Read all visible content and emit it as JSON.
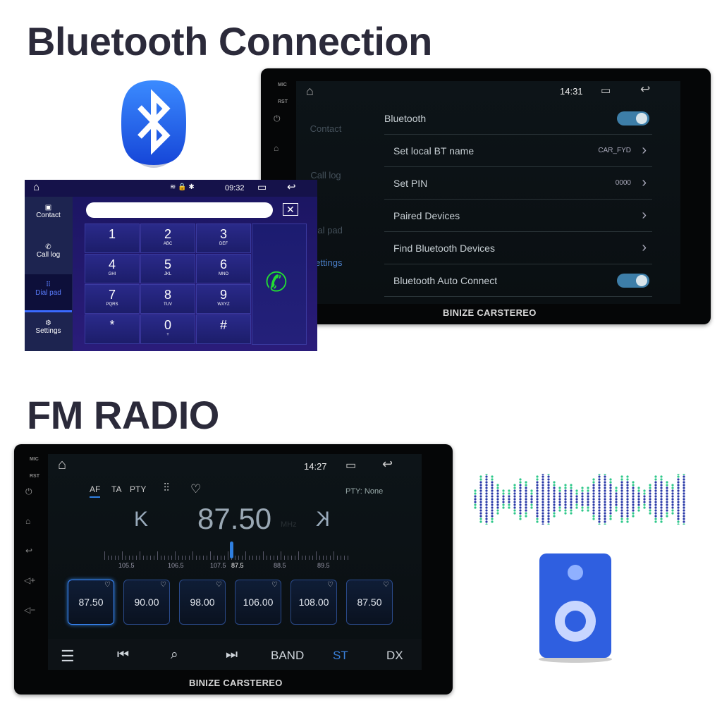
{
  "bt_section": {
    "title": "Bluetooth Connection"
  },
  "fm_section": {
    "title": "FM RADIO"
  },
  "brand": "BINIZE CARSTEREO",
  "bezel": {
    "mic": "MIC",
    "rst": "RST"
  },
  "bt_unit": {
    "time": "14:31",
    "sidebar": [
      "Contact",
      "Call log",
      "Dial pad",
      "Settings"
    ],
    "rows": [
      {
        "label": "Bluetooth",
        "type": "toggle",
        "on": true
      },
      {
        "label": "Set local BT name",
        "value": "CAR_FYD",
        "type": "chevron"
      },
      {
        "label": "Set PIN",
        "value": "0000",
        "type": "chevron"
      },
      {
        "label": "Paired Devices",
        "type": "chevron"
      },
      {
        "label": "Find Bluetooth Devices",
        "type": "chevron"
      },
      {
        "label": "Bluetooth Auto Connect",
        "type": "toggle",
        "on": true
      }
    ]
  },
  "dialpad": {
    "time": "09:32",
    "sidebar": [
      {
        "label": "Contact",
        "icon": "contact-icon"
      },
      {
        "label": "Call log",
        "icon": "call-log-icon"
      },
      {
        "label": "Dial pad",
        "icon": "dialpad-icon",
        "active": true
      },
      {
        "label": "Settings",
        "icon": "gear-icon"
      }
    ],
    "keys": [
      {
        "n": "1",
        "s": ""
      },
      {
        "n": "2",
        "s": "ABC"
      },
      {
        "n": "3",
        "s": "DEF"
      },
      {
        "n": "4",
        "s": "GHI"
      },
      {
        "n": "5",
        "s": "JKL"
      },
      {
        "n": "6",
        "s": "MNO"
      },
      {
        "n": "7",
        "s": "PQRS"
      },
      {
        "n": "8",
        "s": "TUV"
      },
      {
        "n": "9",
        "s": "WXYZ"
      },
      {
        "n": "*",
        "s": ""
      },
      {
        "n": "0",
        "s": "+"
      },
      {
        "n": "#",
        "s": ""
      }
    ],
    "accent": "#22dd33"
  },
  "fm_unit": {
    "time": "14:27",
    "tabs": [
      "AF",
      "TA",
      "PTY"
    ],
    "pty_status": "PTY: None",
    "frequency": "87.50",
    "unit": "MHz",
    "scale_labels": [
      "105.5",
      "106.5",
      "107.5",
      "87.5",
      "88.5",
      "89.5"
    ],
    "presets": [
      "87.50",
      "90.00",
      "98.00",
      "106.00",
      "108.00",
      "87.50"
    ],
    "controls": {
      "band": "BAND",
      "st": "ST",
      "dx": "DX"
    },
    "accent": "#2f7fe0"
  }
}
